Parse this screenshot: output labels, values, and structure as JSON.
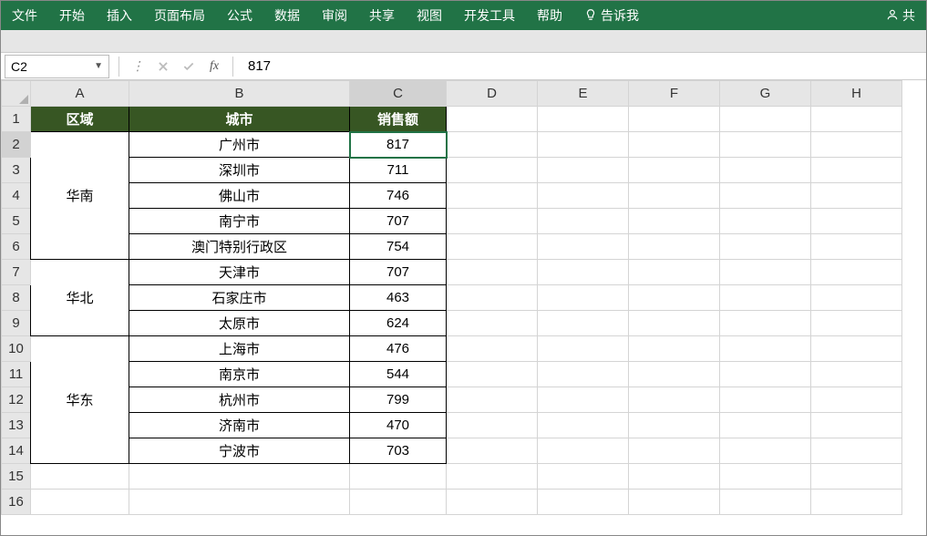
{
  "ribbon": {
    "items": [
      "文件",
      "开始",
      "插入",
      "页面布局",
      "公式",
      "数据",
      "审阅",
      "共享",
      "视图",
      "开发工具",
      "帮助"
    ],
    "tell_me": "告诉我",
    "share": "共"
  },
  "formula_bar": {
    "name_box": "C2",
    "fx_label": "fx",
    "value": "817"
  },
  "columns": [
    "A",
    "B",
    "C",
    "D",
    "E",
    "F",
    "G",
    "H"
  ],
  "row_numbers": [
    1,
    2,
    3,
    4,
    5,
    6,
    7,
    8,
    9,
    10,
    11,
    12,
    13,
    14,
    15,
    16
  ],
  "headers": {
    "region": "区域",
    "city": "城市",
    "sales": "销售额"
  },
  "regions": [
    {
      "name": "华南",
      "rows": [
        {
          "city": "广州市",
          "sales": 817
        },
        {
          "city": "深圳市",
          "sales": 711
        },
        {
          "city": "佛山市",
          "sales": 746
        },
        {
          "city": "南宁市",
          "sales": 707
        },
        {
          "city": "澳门特别行政区",
          "sales": 754
        }
      ]
    },
    {
      "name": "华北",
      "rows": [
        {
          "city": "天津市",
          "sales": 707
        },
        {
          "city": "石家庄市",
          "sales": 463
        },
        {
          "city": "太原市",
          "sales": 624
        }
      ]
    },
    {
      "name": "华东",
      "rows": [
        {
          "city": "上海市",
          "sales": 476
        },
        {
          "city": "南京市",
          "sales": 544
        },
        {
          "city": "杭州市",
          "sales": 799
        },
        {
          "city": "济南市",
          "sales": 470
        },
        {
          "city": "宁波市",
          "sales": 703
        }
      ]
    }
  ],
  "active_cell": {
    "col": "C",
    "row": 2
  }
}
